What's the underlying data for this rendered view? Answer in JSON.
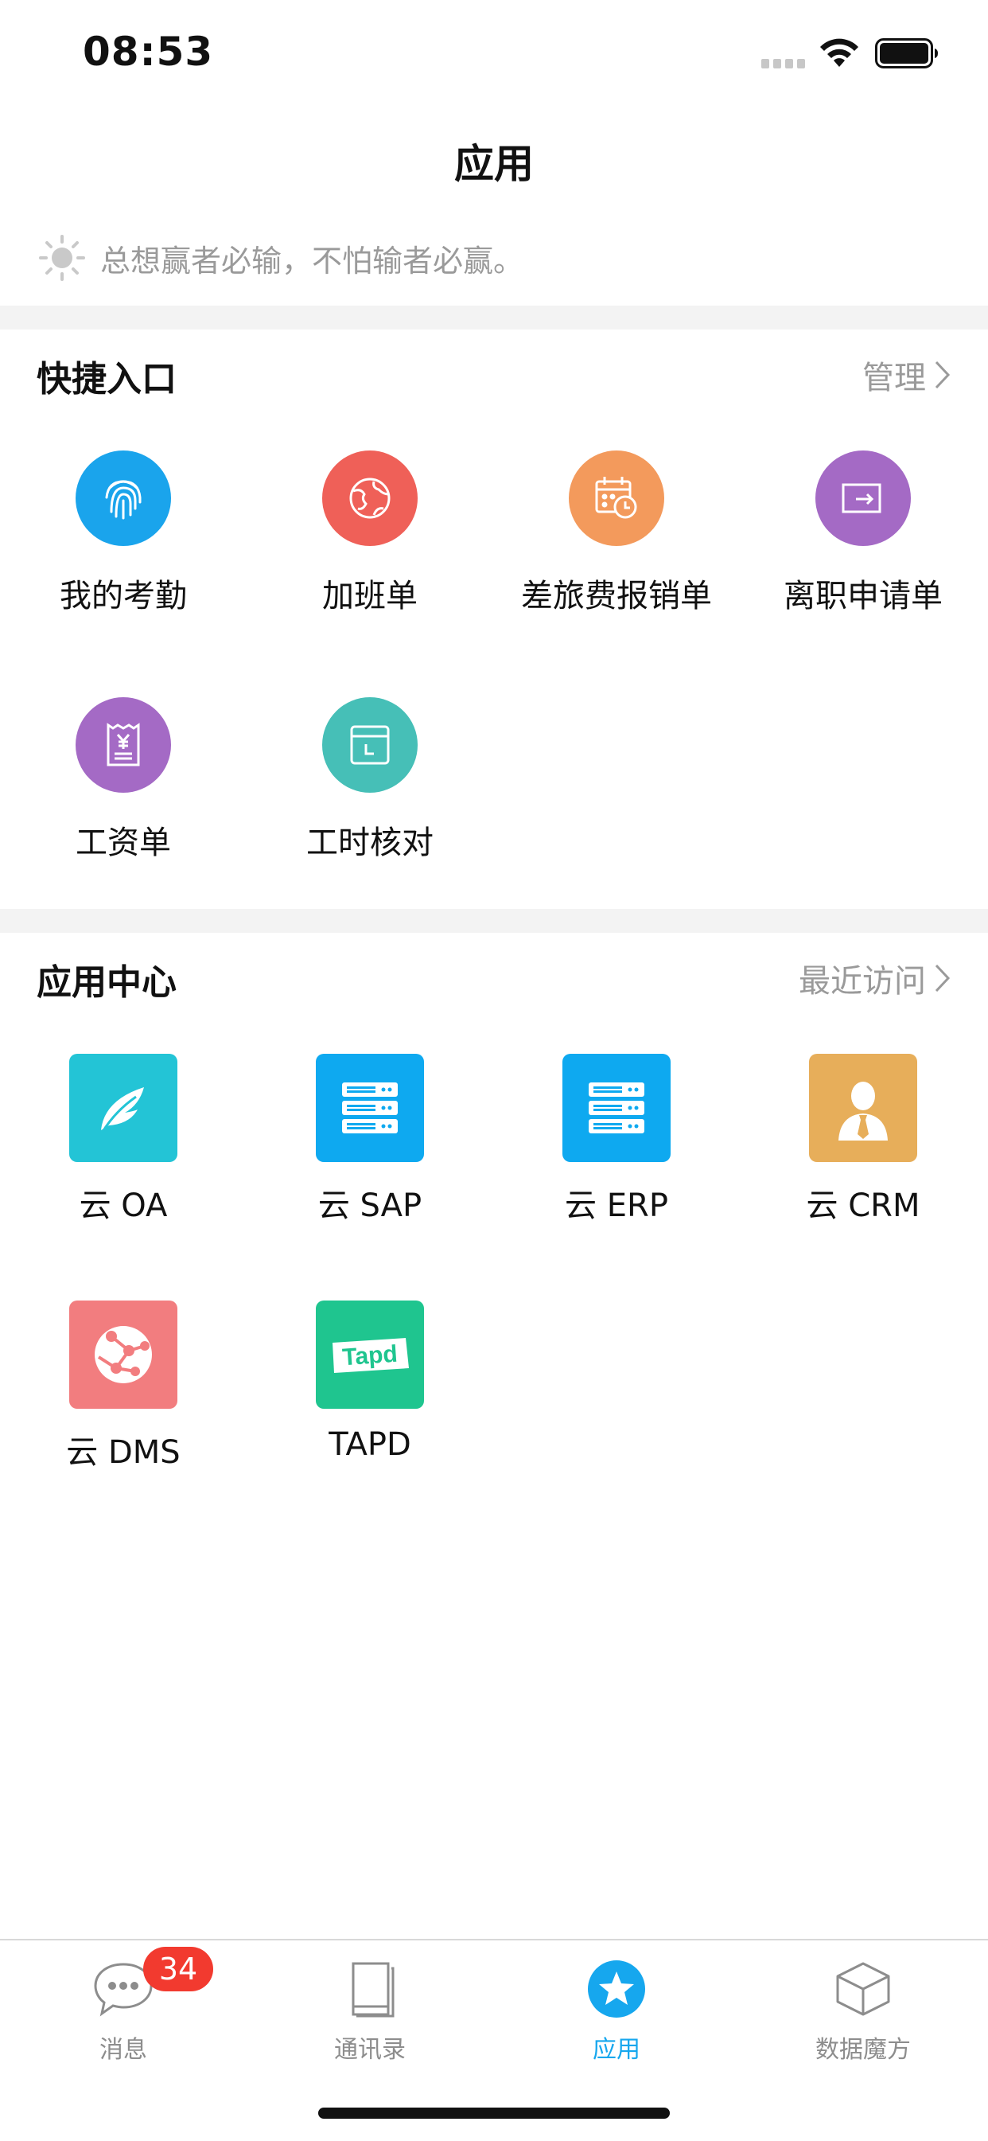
{
  "status_bar": {
    "time": "08:53"
  },
  "page": {
    "title": "应用"
  },
  "motto": "总想赢者必输，不怕输者必赢。",
  "quick_access": {
    "title": "快捷入口",
    "link": "管理",
    "items": [
      {
        "label": "我的考勤",
        "icon": "fingerprint-icon",
        "color": "#1aa4ec"
      },
      {
        "label": "加班单",
        "icon": "globe-icon",
        "color": "#ef6058"
      },
      {
        "label": "差旅费报销单",
        "icon": "calendar-clock-icon",
        "color": "#f39a5c"
      },
      {
        "label": "离职申请单",
        "icon": "exit-icon",
        "color": "#a46ac5"
      },
      {
        "label": "工资单",
        "icon": "receipt-yen-icon",
        "color": "#a46ac5"
      },
      {
        "label": "工时核对",
        "icon": "calendar-check-icon",
        "color": "#46bfb7"
      }
    ]
  },
  "app_center": {
    "title": "应用中心",
    "link": "最近访问",
    "items": [
      {
        "label": "云 OA",
        "icon": "feather-icon",
        "color": "#23c4d6"
      },
      {
        "label": "云 SAP",
        "icon": "server-icon",
        "color": "#0ea9f0"
      },
      {
        "label": "云 ERP",
        "icon": "server-icon",
        "color": "#0ea9f0"
      },
      {
        "label": "云 CRM",
        "icon": "person-icon",
        "color": "#e7ae5a"
      },
      {
        "label": "云 DMS",
        "icon": "network-ball-icon",
        "color": "#f27d7f"
      },
      {
        "label": "TAPD",
        "icon": "tapd-logo-icon",
        "color": "#1fc58f"
      }
    ]
  },
  "tab_bar": {
    "badge": "34",
    "tabs": [
      {
        "label": "消息",
        "icon": "chat-bubble-icon"
      },
      {
        "label": "通讯录",
        "icon": "book-icon"
      },
      {
        "label": "应用",
        "icon": "star-icon",
        "active": true
      },
      {
        "label": "数据魔方",
        "icon": "cube-icon"
      }
    ]
  }
}
